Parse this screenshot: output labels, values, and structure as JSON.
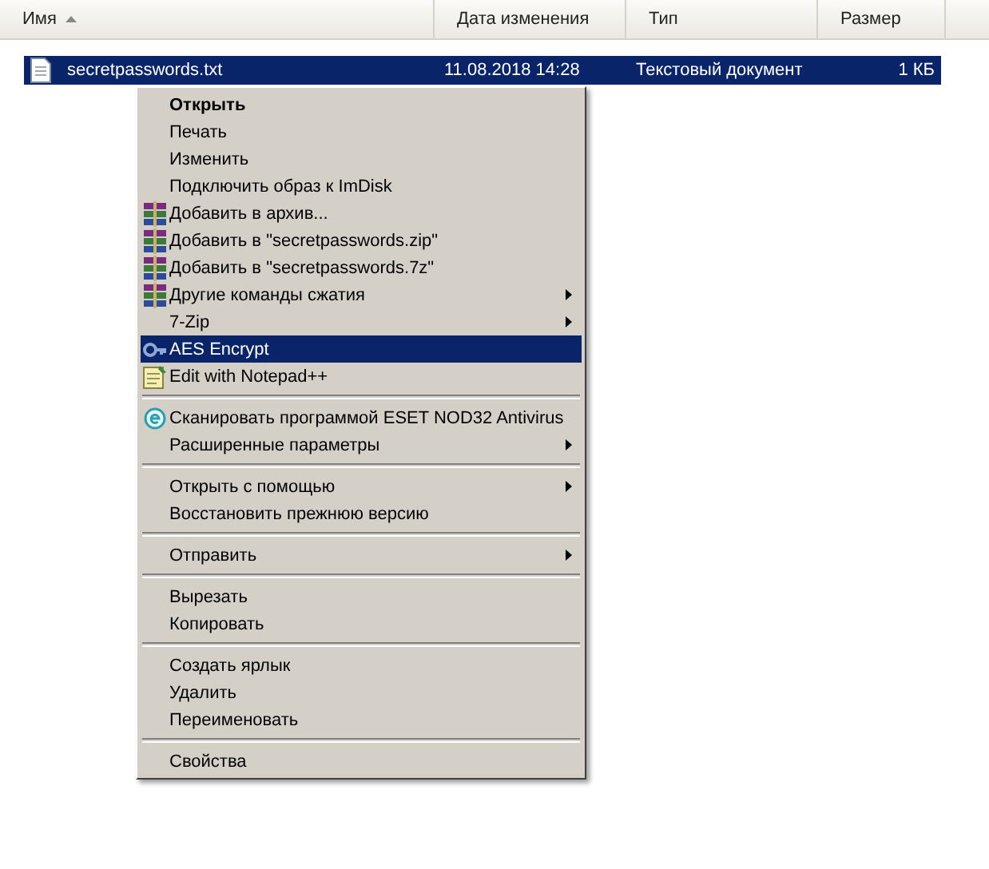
{
  "columns": [
    {
      "label": "Имя",
      "sorted": true
    },
    {
      "label": "Дата изменения",
      "sorted": false
    },
    {
      "label": "Тип",
      "sorted": false
    },
    {
      "label": "Размер",
      "sorted": false
    }
  ],
  "file": {
    "name": "secretpasswords.txt",
    "date": "11.08.2018 14:28",
    "type": "Текстовый документ",
    "size": "1 КБ",
    "selected": true
  },
  "menu": [
    {
      "kind": "plain",
      "label": "Открыть",
      "default": true,
      "selected": false
    },
    {
      "kind": "plain",
      "label": "Печать",
      "selected": false
    },
    {
      "kind": "plain",
      "label": "Изменить",
      "selected": false
    },
    {
      "kind": "plain",
      "label": "Подключить образ к ImDisk",
      "selected": false
    },
    {
      "kind": "archive",
      "label": "Добавить в архив...",
      "selected": false
    },
    {
      "kind": "archive",
      "label": "Добавить в \"secretpasswords.zip\"",
      "selected": false
    },
    {
      "kind": "archive",
      "label": "Добавить в \"secretpasswords.7z\"",
      "selected": false
    },
    {
      "kind": "archive",
      "label": "Другие команды сжатия",
      "submenu": true,
      "selected": false
    },
    {
      "kind": "plain",
      "label": "7-Zip",
      "submenu": true,
      "selected": false
    },
    {
      "kind": "key",
      "label": "AES Encrypt",
      "selected": true
    },
    {
      "kind": "notepad",
      "label": "Edit with Notepad++",
      "selected": false
    },
    {
      "kind": "separator"
    },
    {
      "kind": "antivirus",
      "label": "Сканировать программой ESET NOD32 Antivirus",
      "selected": false
    },
    {
      "kind": "plain",
      "label": "Расширенные параметры",
      "submenu": true,
      "selected": false
    },
    {
      "kind": "separator"
    },
    {
      "kind": "plain",
      "label": "Открыть с помощью",
      "submenu": true,
      "selected": false
    },
    {
      "kind": "plain",
      "label": "Восстановить прежнюю версию",
      "selected": false
    },
    {
      "kind": "separator"
    },
    {
      "kind": "plain",
      "label": "Отправить",
      "submenu": true,
      "selected": false
    },
    {
      "kind": "separator"
    },
    {
      "kind": "plain",
      "label": "Вырезать",
      "selected": false
    },
    {
      "kind": "plain",
      "label": "Копировать",
      "selected": false
    },
    {
      "kind": "separator"
    },
    {
      "kind": "plain",
      "label": "Создать ярлык",
      "selected": false
    },
    {
      "kind": "plain",
      "label": "Удалить",
      "selected": false
    },
    {
      "kind": "plain",
      "label": "Переименовать",
      "selected": false
    },
    {
      "kind": "separator"
    },
    {
      "kind": "plain",
      "label": "Свойства",
      "selected": false
    }
  ]
}
